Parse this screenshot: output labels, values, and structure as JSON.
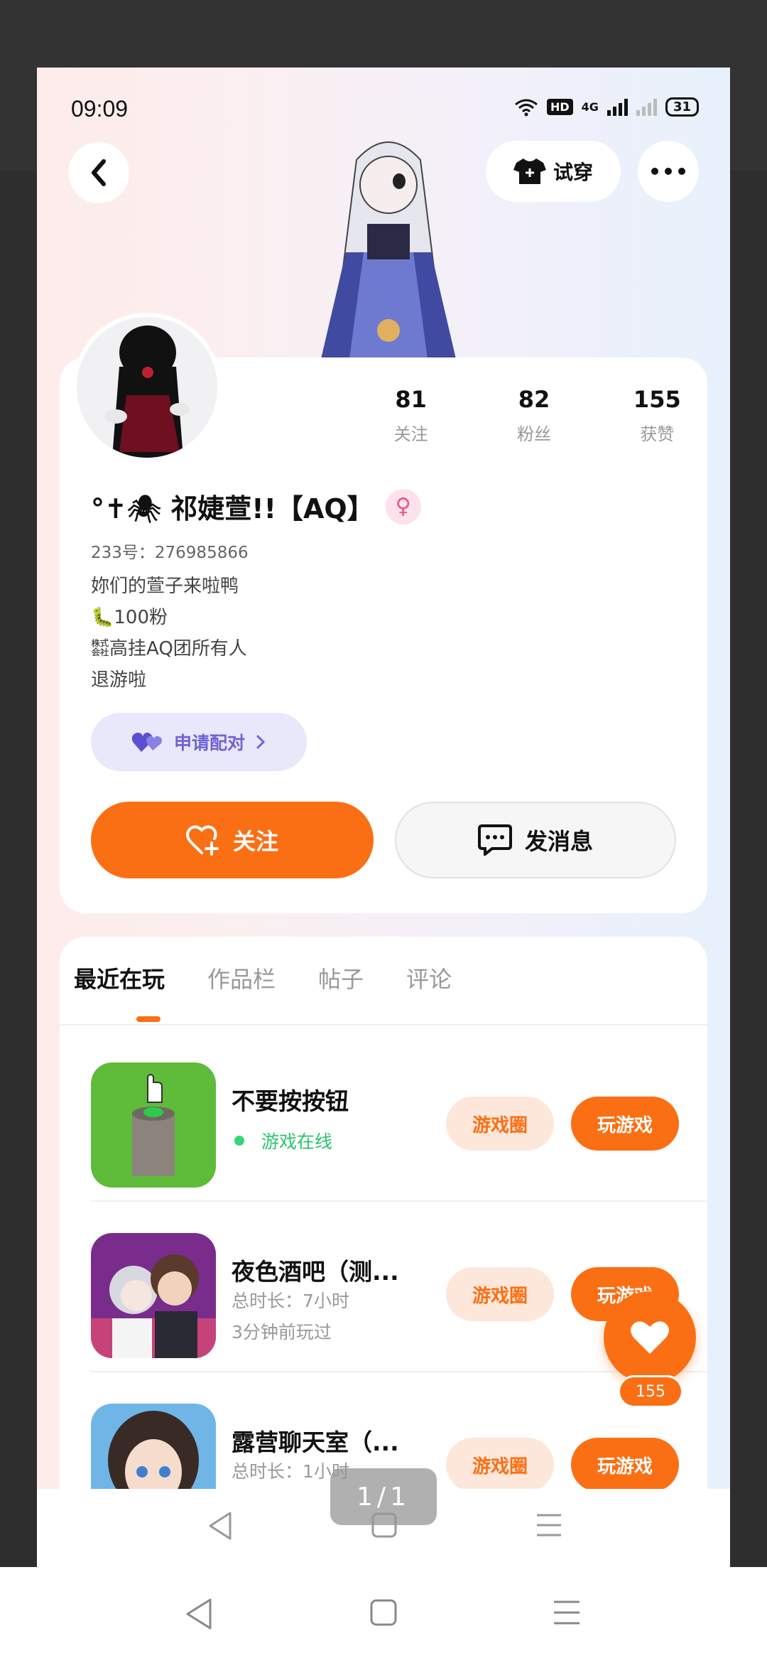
{
  "status_bar": {
    "time": "09:09",
    "hd": "HD",
    "network": "4G",
    "battery": "31"
  },
  "header": {
    "try_on_label": "试穿"
  },
  "profile": {
    "stats": [
      {
        "value": "81",
        "label": "关注"
      },
      {
        "value": "82",
        "label": "粉丝"
      },
      {
        "value": "155",
        "label": "获赞"
      }
    ],
    "name": "°✝🕷 祁婕萱!!【AQ】",
    "uid": "233号：276985866",
    "bio": [
      "妳们的萱子来啦鸭",
      "🐛100粉",
      "㍿高挂AQ团所有人",
      "退游啦"
    ],
    "cp_label": "申请配对",
    "follow_label": "关注",
    "message_label": "发消息"
  },
  "tabs": [
    "最近在玩",
    "作品栏",
    "帖子",
    "评论"
  ],
  "games": [
    {
      "title": "不要按按钮",
      "sub1": "游戏在线",
      "sub2": "",
      "circle_label": "游戏圈",
      "play_label": "玩游戏"
    },
    {
      "title": "夜色酒吧（测...",
      "sub1": "总时长：7小时",
      "sub2": "3分钟前玩过",
      "circle_label": "游戏圈",
      "play_label": "玩游戏"
    },
    {
      "title": "露营聊天室（...",
      "sub1": "总时长：1小时",
      "sub2": "",
      "circle_label": "游戏圈",
      "play_label": "玩游戏"
    }
  ],
  "like_count": "155",
  "page_indicator": "1/1",
  "colors": {
    "accent": "#fb6f14",
    "online": "#27c46a",
    "cp": "#6f63d6"
  }
}
